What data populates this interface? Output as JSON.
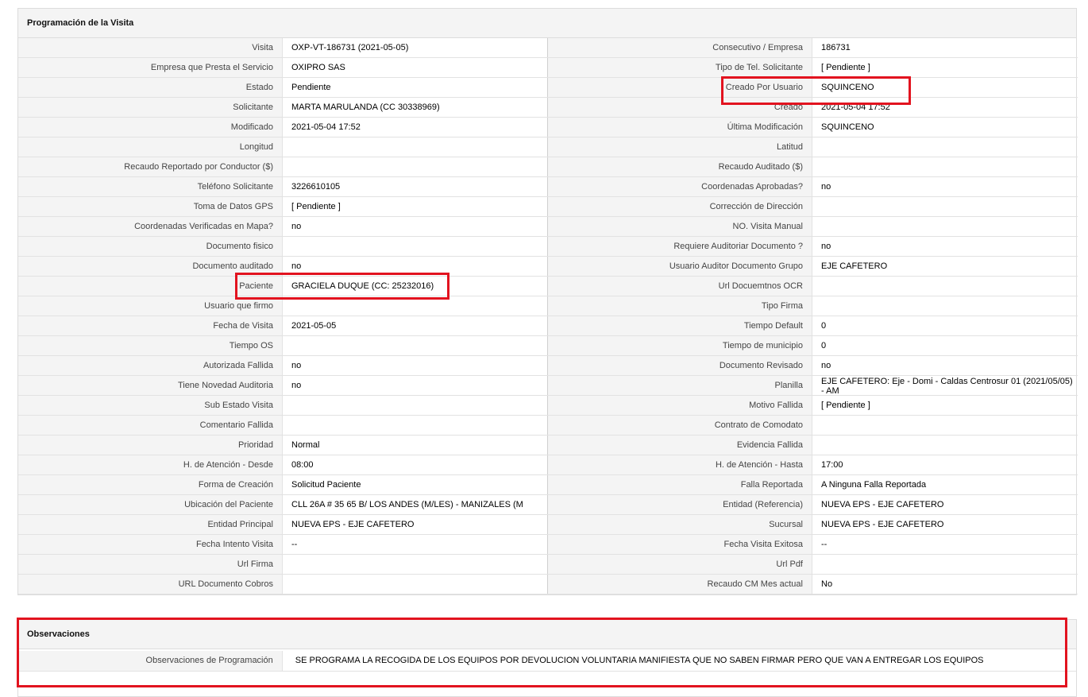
{
  "programacion": {
    "title": "Programación de la Visita",
    "left": [
      {
        "label": "Visita",
        "value": "OXP-VT-186731 (2021-05-05)"
      },
      {
        "label": "Empresa que Presta el Servicio",
        "value": "OXIPRO SAS"
      },
      {
        "label": "Estado",
        "value": "Pendiente"
      },
      {
        "label": "Solicitante",
        "value": "MARTA MARULANDA (CC 30338969)"
      },
      {
        "label": "Modificado",
        "value": "2021-05-04 17:52"
      },
      {
        "label": "Longitud",
        "value": ""
      },
      {
        "label": "Recaudo Reportado por Conductor ($)",
        "value": ""
      },
      {
        "label": "Teléfono Solicitante",
        "value": "3226610105"
      },
      {
        "label": "Toma de Datos GPS",
        "value": "[ Pendiente ]"
      },
      {
        "label": "Coordenadas Verificadas en Mapa?",
        "value": " no"
      },
      {
        "label": "Documento fisico",
        "value": ""
      },
      {
        "label": "Documento auditado",
        "value": "no"
      },
      {
        "label": "Paciente",
        "value": "GRACIELA DUQUE (CC: 25232016)"
      },
      {
        "label": "Usuario que firmo",
        "value": ""
      },
      {
        "label": "Fecha de Visita",
        "value": " 2021-05-05"
      },
      {
        "label": "Tiempo OS",
        "value": ""
      },
      {
        "label": "Autorizada Fallida",
        "value": " no"
      },
      {
        "label": "Tiene Novedad Auditoria",
        "value": " no"
      },
      {
        "label": "Sub Estado Visita",
        "value": ""
      },
      {
        "label": "Comentario Fallida",
        "value": ""
      },
      {
        "label": "Prioridad",
        "value": "Normal"
      },
      {
        "label": "H. de Atención - Desde",
        "value": "08:00"
      },
      {
        "label": "Forma de Creación",
        "value": "Solicitud Paciente"
      },
      {
        "label": "Ubicación del Paciente",
        "value": "CLL 26A # 35 65 B/ LOS ANDES (M/LES) - MANIZALES (M"
      },
      {
        "label": "Entidad Principal",
        "value": "NUEVA EPS - EJE CAFETERO"
      },
      {
        "label": "Fecha Intento Visita",
        "value": "--"
      },
      {
        "label": "Url Firma",
        "value": ""
      },
      {
        "label": "URL Documento Cobros",
        "value": ""
      }
    ],
    "right": [
      {
        "label": "Consecutivo / Empresa",
        "value": "186731"
      },
      {
        "label": "Tipo de Tel. Solicitante",
        "value": "[ Pendiente ]"
      },
      {
        "label": "Creado Por Usuario",
        "value": "SQUINCENO"
      },
      {
        "label": "Creado",
        "value": "2021-05-04 17:52"
      },
      {
        "label": "Última Modificación",
        "value": " SQUINCENO"
      },
      {
        "label": "Latitud",
        "value": ""
      },
      {
        "label": "Recaudo Auditado ($)",
        "value": ""
      },
      {
        "label": "Coordenadas Aprobadas?",
        "value": " no"
      },
      {
        "label": "Corrección de Dirección",
        "value": ""
      },
      {
        "label": "NO. Visita Manual",
        "value": ""
      },
      {
        "label": "Requiere Auditoriar Documento ?",
        "value": " no"
      },
      {
        "label": "Usuario Auditor Documento Grupo",
        "value": "EJE CAFETERO"
      },
      {
        "label": "Url Docuemtnos OCR",
        "value": ""
      },
      {
        "label": "Tipo Firma",
        "value": ""
      },
      {
        "label": "Tiempo Default",
        "value": "0"
      },
      {
        "label": "Tiempo de municipio",
        "value": "0"
      },
      {
        "label": "Documento Revisado",
        "value": " no"
      },
      {
        "label": "Planilla",
        "value": "EJE CAFETERO: Eje - Domi - Caldas Centrosur 01 (2021/05/05) - AM"
      },
      {
        "label": "Motivo Fallida",
        "value": "[ Pendiente ]"
      },
      {
        "label": "Contrato de Comodato",
        "value": ""
      },
      {
        "label": "Evidencia Fallida",
        "value": ""
      },
      {
        "label": "H. de Atención - Hasta",
        "value": "17:00"
      },
      {
        "label": "Falla Reportada",
        "value": "A Ninguna Falla Reportada"
      },
      {
        "label": "Entidad (Referencia)",
        "value": "NUEVA EPS - EJE CAFETERO"
      },
      {
        "label": "Sucursal",
        "value": "NUEVA EPS - EJE CAFETERO"
      },
      {
        "label": "Fecha Visita Exitosa",
        "value": " --"
      },
      {
        "label": "Url Pdf",
        "value": ""
      },
      {
        "label": "Recaudo CM Mes actual",
        "value": "No"
      }
    ]
  },
  "observaciones": {
    "title": "Observaciones",
    "label": "Observaciones de Programación",
    "value": "SE PROGRAMA LA RECOGIDA DE LOS EQUIPOS POR DEVOLUCION VOLUNTARIA MANIFIESTA QUE NO SABEN FIRMAR PERO QUE VAN A ENTREGAR LOS EQUIPOS"
  },
  "colors": {
    "highlight": "#e2131f"
  }
}
